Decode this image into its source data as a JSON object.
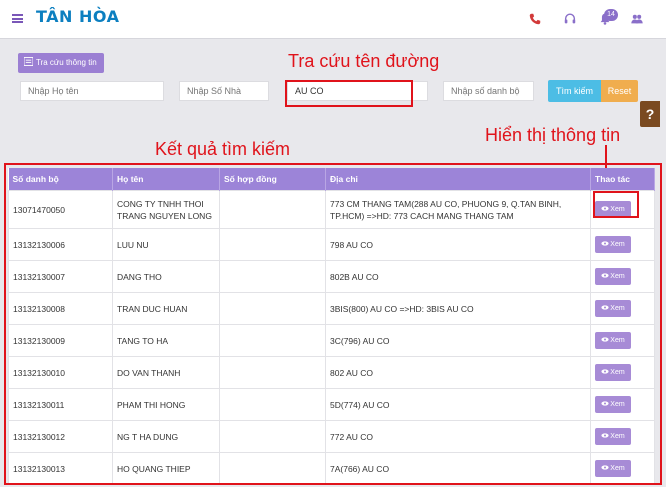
{
  "app": {
    "logo": "TÂN HÒA",
    "notification_count": "14"
  },
  "search": {
    "lookup_button_label": "Tra cứu thông tin",
    "name_placeholder": "Nhập Họ tên",
    "house_no_placeholder": "Nhập Số Nhà",
    "street_value": "AU CO",
    "account_no_placeholder": "Nhập số danh bộ",
    "search_button": "Tìm kiếm",
    "reset_button": "Reset"
  },
  "annotations": {
    "street_lookup": "Tra cứu tên đường",
    "results": "Kết quả tìm kiếm",
    "show_info": "Hiển thị thông tin"
  },
  "table": {
    "headers": [
      "Số danh bộ",
      "Họ tên",
      "Số hợp đồng",
      "Địa chỉ",
      "Thao tác"
    ],
    "view_label": "Xem",
    "rows": [
      {
        "account": "13071470050",
        "name": "CONG TY TNHH THOI TRANG NGUYEN LONG",
        "contract": "",
        "address": "773 CM THANG TAM(288 AU CO, PHUONG 9, Q.TAN BINH, TP.HCM) =>HD: 773 CACH MANG THANG TAM"
      },
      {
        "account": "13132130006",
        "name": "LUU NU",
        "contract": "",
        "address": "798 AU CO"
      },
      {
        "account": "13132130007",
        "name": "DANG THO",
        "contract": "",
        "address": "802B AU CO"
      },
      {
        "account": "13132130008",
        "name": "TRAN DUC HUAN",
        "contract": "",
        "address": "3BIS(800) AU CO =>HD: 3BIS AU CO"
      },
      {
        "account": "13132130009",
        "name": "TANG TO HA",
        "contract": "",
        "address": "3C(796) AU CO"
      },
      {
        "account": "13132130010",
        "name": "DO VAN THANH",
        "contract": "",
        "address": "802 AU CO"
      },
      {
        "account": "13132130011",
        "name": "PHAM THI HONG",
        "contract": "",
        "address": "5D(774) AU CO"
      },
      {
        "account": "13132130012",
        "name": "NG T HA DUNG",
        "contract": "",
        "address": "772 AU CO"
      },
      {
        "account": "13132130013",
        "name": "HO QUANG THIEP",
        "contract": "",
        "address": "7A(766) AU CO"
      }
    ]
  }
}
